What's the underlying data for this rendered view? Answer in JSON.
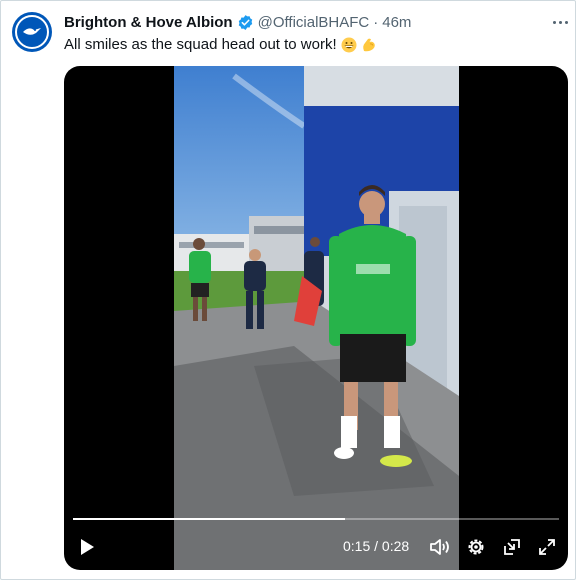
{
  "tweet": {
    "display_name": "Brighton & Hove Albion",
    "handle": "@OfficialBHAFC",
    "separator": "·",
    "time": "46m",
    "text": "All smiles as the squad head out to work!",
    "emojis": [
      "grinning-face",
      "flexed-biceps"
    ],
    "verified": true
  },
  "video": {
    "current_time": "0:15",
    "time_separator": "/",
    "duration": "0:28",
    "progress_fraction": 0.56,
    "controls": [
      "play-icon",
      "volume-icon",
      "settings-icon",
      "pip-icon",
      "fullscreen-icon"
    ]
  },
  "colors": {
    "brand_blue": "#0057b8",
    "verified_blue": "#1d9bf0",
    "kit_green": "#27b34a",
    "text_primary": "#0f1419",
    "text_secondary": "#536471"
  }
}
